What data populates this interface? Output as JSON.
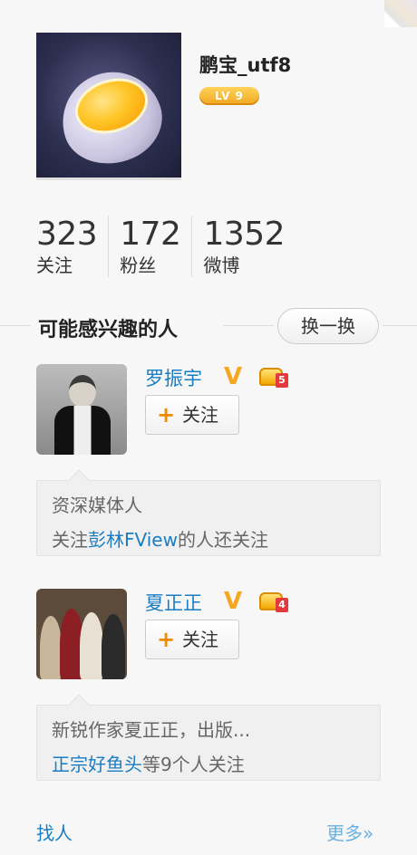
{
  "profile": {
    "username": "鹏宝_utf8",
    "level": "LV 9"
  },
  "stats": [
    {
      "value": "323",
      "label": "关注"
    },
    {
      "value": "172",
      "label": "粉丝"
    },
    {
      "value": "1352",
      "label": "微博"
    }
  ],
  "suggestions": {
    "title": "可能感兴趣的人",
    "refresh_label": "换一换",
    "items": [
      {
        "name": "罗振宇",
        "verified_icon": "V",
        "member_level": "5",
        "follow_label": "关注",
        "desc": "资深媒体人",
        "reason_prefix": "关注",
        "reason_link": "彭林FView",
        "reason_suffix": "的人还关注"
      },
      {
        "name": "夏正正",
        "verified_icon": "V",
        "member_level": "4",
        "follow_label": "关注",
        "desc": "新锐作家夏正正，出版...",
        "reason_prefix": "",
        "reason_link": "正宗好鱼头",
        "reason_suffix": "等9个人关注"
      }
    ]
  },
  "footer": {
    "find_people": "找人",
    "more": "更多»"
  },
  "colors": {
    "link": "#1a7dc2",
    "accent_orange": "#f08a00",
    "level_badge": "#f0a620"
  }
}
